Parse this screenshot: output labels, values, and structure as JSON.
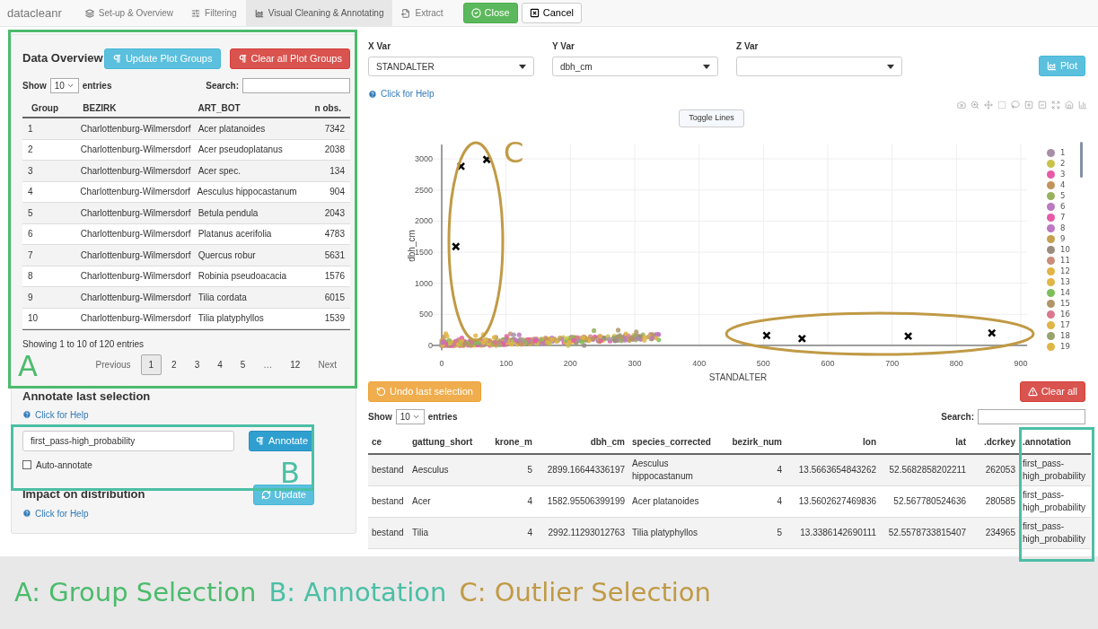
{
  "navbar": {
    "brand": "datacleanr",
    "tabs": [
      {
        "label": "Set-up & Overview",
        "selected": false
      },
      {
        "label": "Filtering",
        "selected": false
      },
      {
        "label": "Visual Cleaning & Annotating",
        "selected": true
      },
      {
        "label": "Extract",
        "selected": false
      }
    ],
    "buttons": [
      {
        "label": "Close",
        "kind": "success"
      },
      {
        "label": "Cancel",
        "kind": "default"
      }
    ]
  },
  "data_overview": {
    "title": "Data Overview",
    "buttons": [
      {
        "label": "Update Plot Groups",
        "kind": "info"
      },
      {
        "label": "Clear all Plot Groups",
        "kind": "danger"
      }
    ],
    "length": {
      "show": "Show",
      "value": "10",
      "entries": "entries"
    },
    "search_label": "Search:",
    "columns": [
      "Group",
      "BEZIRK",
      "ART_BOT",
      "n obs."
    ],
    "rows": [
      [
        "1",
        "Charlottenburg-Wilmersdorf",
        "Acer platanoides",
        "7342"
      ],
      [
        "2",
        "Charlottenburg-Wilmersdorf",
        "Acer pseudoplatanus",
        "2038"
      ],
      [
        "3",
        "Charlottenburg-Wilmersdorf",
        "Acer spec.",
        "134"
      ],
      [
        "4",
        "Charlottenburg-Wilmersdorf",
        "Aesculus hippocastanum",
        "904"
      ],
      [
        "5",
        "Charlottenburg-Wilmersdorf",
        "Betula pendula",
        "2043"
      ],
      [
        "6",
        "Charlottenburg-Wilmersdorf",
        "Platanus acerifolia",
        "4783"
      ],
      [
        "7",
        "Charlottenburg-Wilmersdorf",
        "Quercus robur",
        "5631"
      ],
      [
        "8",
        "Charlottenburg-Wilmersdorf",
        "Robinia pseudoacacia",
        "1576"
      ],
      [
        "9",
        "Charlottenburg-Wilmersdorf",
        "Tilia cordata",
        "6015"
      ],
      [
        "10",
        "Charlottenburg-Wilmersdorf",
        "Tilia platyphyllos",
        "1539"
      ]
    ],
    "info": "Showing 1 to 10 of 120 entries",
    "pagination": [
      {
        "label": "Previous",
        "kind": "nav",
        "selected": false
      },
      {
        "label": "1",
        "kind": "page",
        "selected": true
      },
      {
        "label": "2",
        "kind": "page",
        "selected": false
      },
      {
        "label": "3",
        "kind": "page",
        "selected": false
      },
      {
        "label": "4",
        "kind": "page",
        "selected": false
      },
      {
        "label": "5",
        "kind": "page",
        "selected": false
      },
      {
        "label": "…",
        "kind": "ellipsis",
        "selected": false
      },
      {
        "label": "12",
        "kind": "page",
        "selected": false
      },
      {
        "label": "Next",
        "kind": "nav",
        "selected": false
      }
    ]
  },
  "annotate": {
    "title": "Annotate last selection",
    "help": "Click for Help",
    "value": "first_pass-high_probability",
    "button": "Annotate",
    "auto": {
      "label": "Auto-annotate",
      "checked": false
    }
  },
  "impact": {
    "title": "Impact on distribution",
    "help": "Click for Help",
    "button": "Update"
  },
  "plot_controls": {
    "selects": [
      {
        "label": "X Var",
        "value": "STANDALTER"
      },
      {
        "label": "Y Var",
        "value": "dbh_cm"
      },
      {
        "label": "Z Var"
      }
    ],
    "plot_button": "Plot",
    "help": "Click for Help",
    "toggle": "Toggle Lines"
  },
  "chart": {
    "chart_data": {
      "type": "scatter",
      "xlabel": "STANDALTER",
      "ylabel": "dbh_cm",
      "xlim": [
        -15,
        910
      ],
      "ylim": [
        -80,
        3230
      ],
      "grid": true,
      "xticks": [
        0,
        100,
        200,
        300,
        400,
        500,
        600,
        700,
        800,
        900
      ],
      "yticks": [
        0,
        500,
        1000,
        1500,
        2000,
        2500,
        3000
      ],
      "x": [
        30,
        70,
        22,
        505,
        560,
        725,
        855
      ],
      "series": [
        {
          "color": "#000000",
          "values": [
            2880,
            2990,
            1590,
            160,
            110,
            150,
            200
          ]
        }
      ]
    },
    "legend": [
      {
        "label": "1",
        "color": "#a78fa8"
      },
      {
        "label": "2",
        "color": "#c8c24a"
      },
      {
        "label": "3",
        "color": "#e65aa8"
      },
      {
        "label": "4",
        "color": "#c2935a"
      },
      {
        "label": "5",
        "color": "#98b15c"
      },
      {
        "label": "6",
        "color": "#bc78c0"
      },
      {
        "label": "7",
        "color": "#e65aa8"
      },
      {
        "label": "8",
        "color": "#bc78c0"
      },
      {
        "label": "9",
        "color": "#c5a050"
      },
      {
        "label": "10",
        "color": "#9a8d7f"
      },
      {
        "label": "11",
        "color": "#c88e7a"
      },
      {
        "label": "12",
        "color": "#e0b545"
      },
      {
        "label": "13",
        "color": "#e0b545"
      },
      {
        "label": "14",
        "color": "#7cbf5a"
      },
      {
        "label": "15",
        "color": "#b09568"
      },
      {
        "label": "16",
        "color": "#d8788e"
      },
      {
        "label": "17",
        "color": "#e0b545"
      },
      {
        "label": "18",
        "color": "#99a370"
      },
      {
        "label": "19",
        "color": "#e0b545"
      }
    ]
  },
  "selection_buttons": [
    {
      "label": "Undo last selection",
      "kind": "warning"
    },
    {
      "label": "Clear all",
      "kind": "danger"
    }
  ],
  "selection_table": {
    "length": {
      "show": "Show",
      "value": "10",
      "entries": "entries"
    },
    "search_label": "Search:",
    "columns": [
      "ce",
      "gattung_short",
      "krone_m",
      "dbh_cm",
      "species_corrected",
      "bezirk_num",
      "lon",
      "lat",
      ".dcrkey",
      ".annotation"
    ],
    "rows": [
      [
        "bestand",
        "Aesculus",
        "5",
        "2899.16644336197",
        "Aesculus hippocastanum",
        "4",
        "13.5663654843262",
        "52.5682858202211",
        "262053",
        "first_pass-high_probability"
      ],
      [
        "bestand",
        "Acer",
        "4",
        "1582.95506399199",
        "Acer platanoides",
        "4",
        "13.5602627469836",
        "52.567780524636",
        "280585",
        "first_pass-high_probability"
      ],
      [
        "bestand",
        "Tilia",
        "4",
        "2992.11293012763",
        "Tilia platyphyllos",
        "5",
        "13.3386142690111",
        "52.5578733815407",
        "234965",
        "first_pass-high_probability"
      ]
    ]
  },
  "callouts": [
    {
      "letter": "A",
      "color": "#4cbb6c"
    },
    {
      "letter": "B",
      "color": "#4bbfa5"
    },
    {
      "letter": "C",
      "color": "#c09a45"
    }
  ],
  "caption": [
    {
      "text": "A: Group Selection",
      "color": "#4cbb6c"
    },
    {
      "text": "B: Annotation",
      "color": "#4bbfa5"
    },
    {
      "text": "C: Outlier Selection",
      "color": "#c09a45"
    }
  ]
}
